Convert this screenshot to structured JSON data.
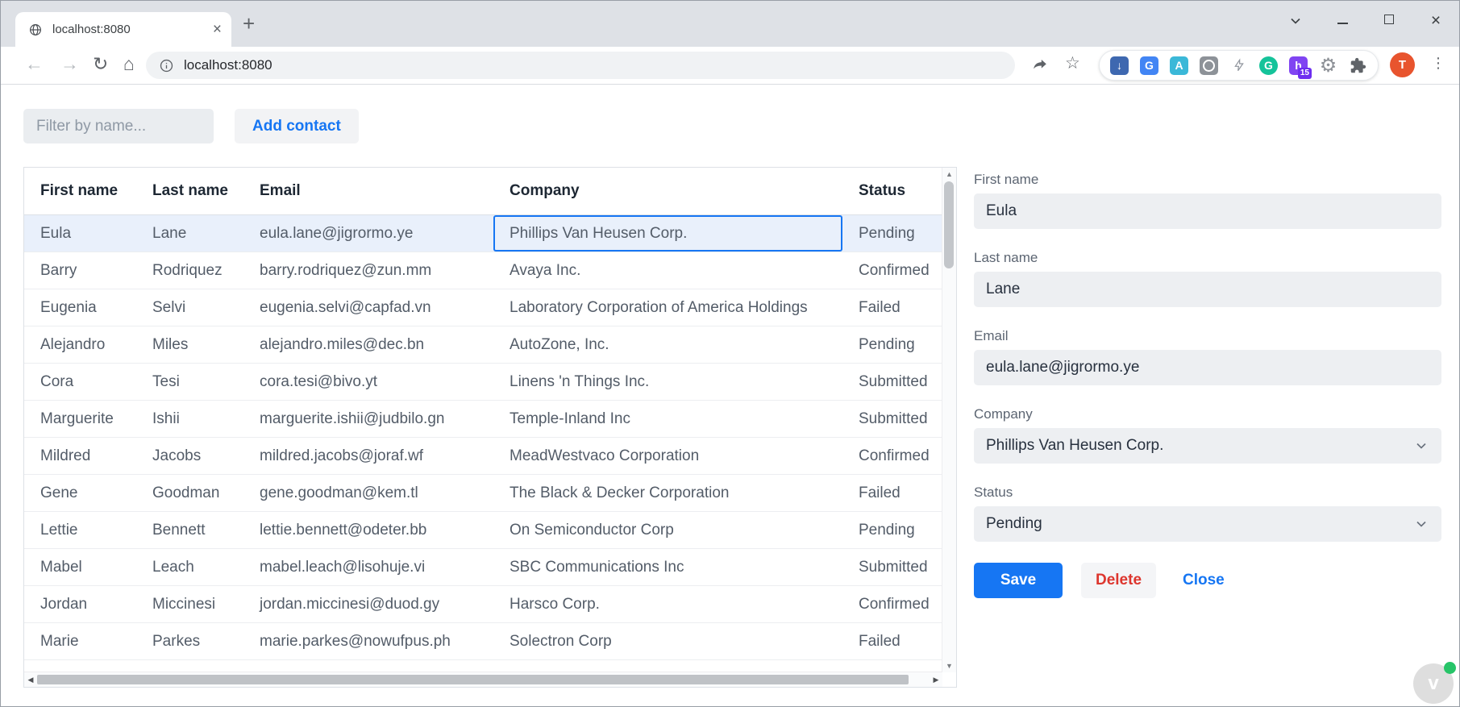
{
  "browser": {
    "tab_title": "localhost:8080",
    "url": "localhost:8080",
    "avatar_initial": "T",
    "honey_badge": "15"
  },
  "icons": {
    "back": "←",
    "forward": "→",
    "reload": "↻",
    "home": "⌂",
    "star": "☆",
    "menu_dots": "⋮",
    "close": "×",
    "new_tab": "+",
    "scroll_up": "▲",
    "scroll_down": "▼",
    "scroll_left": "◀",
    "scroll_right": "▶",
    "download_arrow": "↓",
    "translate_g": "G",
    "annotate_a": "A",
    "grammarly_g": "G",
    "honey_h": "h",
    "gear": "⚙",
    "vaadin_v": "v"
  },
  "page": {
    "filter": {
      "placeholder": "Filter by name..."
    },
    "add_contact_label": "Add contact"
  },
  "grid": {
    "columns": [
      "First name",
      "Last name",
      "Email",
      "Company",
      "Status"
    ],
    "selected_index": 0,
    "rows": [
      {
        "first": "Eula",
        "last": "Lane",
        "email": "eula.lane@jigrormo.ye",
        "company": "Phillips Van Heusen Corp.",
        "status": "Pending"
      },
      {
        "first": "Barry",
        "last": "Rodriquez",
        "email": "barry.rodriquez@zun.mm",
        "company": "Avaya Inc.",
        "status": "Confirmed"
      },
      {
        "first": "Eugenia",
        "last": "Selvi",
        "email": "eugenia.selvi@capfad.vn",
        "company": "Laboratory Corporation of America Holdings",
        "status": "Failed"
      },
      {
        "first": "Alejandro",
        "last": "Miles",
        "email": "alejandro.miles@dec.bn",
        "company": "AutoZone, Inc.",
        "status": "Pending"
      },
      {
        "first": "Cora",
        "last": "Tesi",
        "email": "cora.tesi@bivo.yt",
        "company": "Linens 'n Things Inc.",
        "status": "Submitted"
      },
      {
        "first": "Marguerite",
        "last": "Ishii",
        "email": "marguerite.ishii@judbilo.gn",
        "company": "Temple-Inland Inc",
        "status": "Submitted"
      },
      {
        "first": "Mildred",
        "last": "Jacobs",
        "email": "mildred.jacobs@joraf.wf",
        "company": "MeadWestvaco Corporation",
        "status": "Confirmed"
      },
      {
        "first": "Gene",
        "last": "Goodman",
        "email": "gene.goodman@kem.tl",
        "company": "The Black & Decker Corporation",
        "status": "Failed"
      },
      {
        "first": "Lettie",
        "last": "Bennett",
        "email": "lettie.bennett@odeter.bb",
        "company": "On Semiconductor Corp",
        "status": "Pending"
      },
      {
        "first": "Mabel",
        "last": "Leach",
        "email": "mabel.leach@lisohuje.vi",
        "company": "SBC Communications Inc",
        "status": "Submitted"
      },
      {
        "first": "Jordan",
        "last": "Miccinesi",
        "email": "jordan.miccinesi@duod.gy",
        "company": "Harsco Corp.",
        "status": "Confirmed"
      },
      {
        "first": "Marie",
        "last": "Parkes",
        "email": "marie.parkes@nowufpus.ph",
        "company": "Solectron Corp",
        "status": "Failed"
      }
    ]
  },
  "form": {
    "first_name": {
      "label": "First name",
      "value": "Eula"
    },
    "last_name": {
      "label": "Last name",
      "value": "Lane"
    },
    "email": {
      "label": "Email",
      "value": "eula.lane@jigrormo.ye"
    },
    "company": {
      "label": "Company",
      "value": "Phillips Van Heusen Corp."
    },
    "status": {
      "label": "Status",
      "value": "Pending"
    },
    "save_label": "Save",
    "delete_label": "Delete",
    "close_label": "Close"
  },
  "colors": {
    "primary": "#1676f3",
    "error": "#dd362e",
    "selected_row": "#e9f0fb",
    "grammarly_green": "#15c39a",
    "honey_purple": "#8044f2",
    "avatar_orange": "#e8542e"
  }
}
